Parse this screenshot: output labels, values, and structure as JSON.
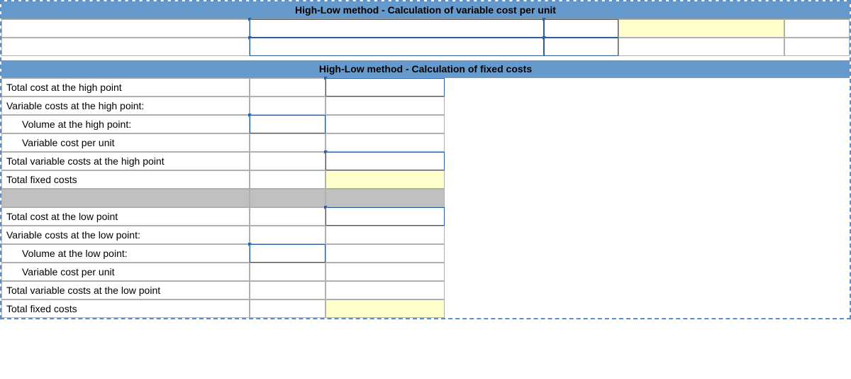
{
  "section1": {
    "header": "High-Low method - Calculation of variable cost per unit"
  },
  "section2": {
    "header": "High-Low method - Calculation of fixed costs",
    "rows_high": {
      "total_cost": "Total cost at the high point",
      "variable_costs": "Variable costs at the high point:",
      "volume": "Volume at the high point:",
      "var_cost_unit": "Variable cost per unit",
      "total_var_costs": "Total variable costs at the high point",
      "total_fixed": "Total fixed costs"
    },
    "rows_low": {
      "total_cost": "Total cost at the low point",
      "variable_costs": "Variable costs at the low point:",
      "volume": "Volume at the low point:",
      "var_cost_unit": "Variable cost per unit",
      "total_var_costs": "Total variable costs at the low point",
      "total_fixed": "Total fixed costs"
    }
  }
}
